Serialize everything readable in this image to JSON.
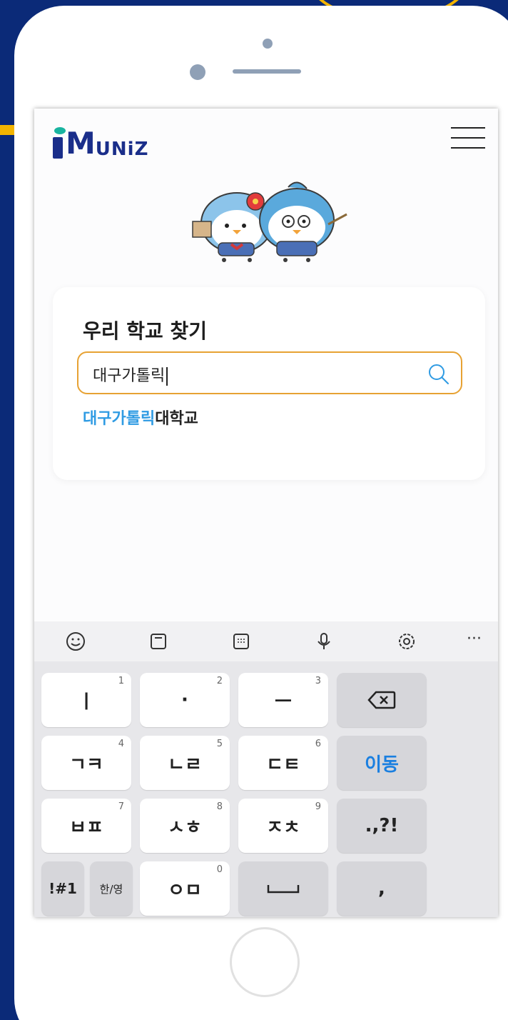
{
  "header": {
    "logo_i": "i",
    "logo_m": "M",
    "logo_rest": "UNiZ"
  },
  "search_section": {
    "title": "우리 학교 찾기",
    "input_value": "대구가톨릭",
    "suggestion_highlight": "대구가톨릭",
    "suggestion_rest": "대학교"
  },
  "keyboard": {
    "toolbar_icons": [
      "emoji-icon",
      "clipboard-icon",
      "keypad-icon",
      "microphone-icon",
      "settings-icon",
      "more-icon"
    ],
    "more_label": "···",
    "rows": [
      [
        {
          "label": "ㅣ",
          "num": "1"
        },
        {
          "label": "·",
          "num": "2"
        },
        {
          "label": "ㅡ",
          "num": "3"
        },
        {
          "label": "",
          "num": ""
        }
      ],
      [
        {
          "label": "ㄱㅋ",
          "num": "4"
        },
        {
          "label": "ㄴㄹ",
          "num": "5"
        },
        {
          "label": "ㄷㅌ",
          "num": "6"
        },
        {
          "label": "이동",
          "num": ""
        }
      ],
      [
        {
          "label": "ㅂㅍ",
          "num": "7"
        },
        {
          "label": "ㅅㅎ",
          "num": "8"
        },
        {
          "label": "ㅈㅊ",
          "num": "9"
        },
        {
          "label": ".,?!",
          "num": ""
        }
      ],
      [
        {
          "label": "!#1",
          "num": ""
        },
        {
          "label": "한/영",
          "num": ""
        },
        {
          "label": "ㅇㅁ",
          "num": "0"
        },
        {
          "label": "",
          "num": ""
        },
        {
          "label": ",",
          "num": ""
        }
      ]
    ]
  },
  "colors": {
    "accent": "#e7a233",
    "highlight": "#2f9be3",
    "brand": "#1a2e8a",
    "background": "#0b2a78"
  }
}
